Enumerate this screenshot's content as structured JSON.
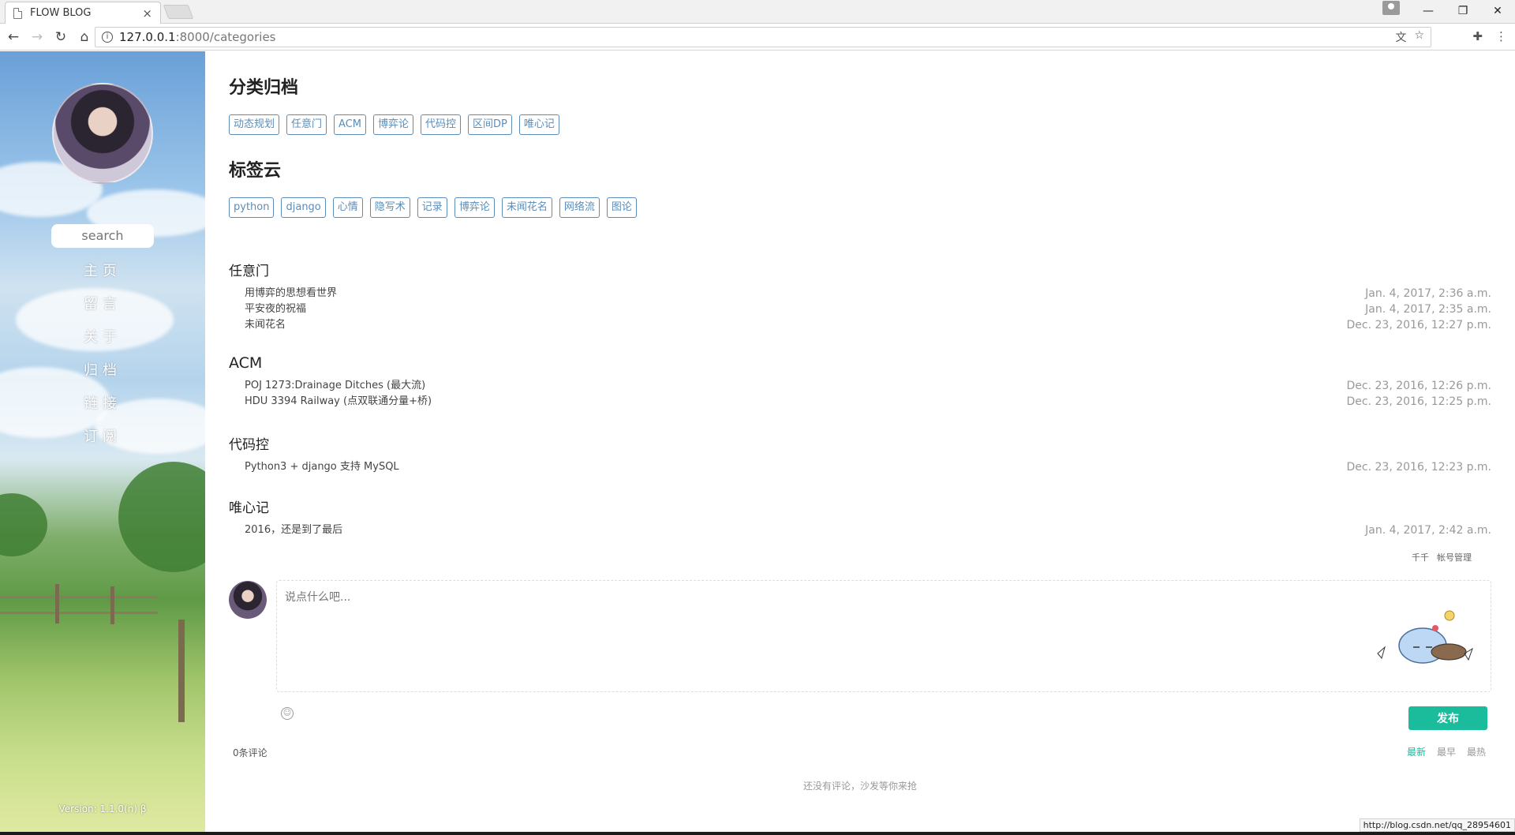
{
  "browser": {
    "tab_title": "FLOW BLOG",
    "tab_close": "×",
    "url_host": "127.0.0.1",
    "url_path": ":8000/categories",
    "status_url": "http://blog.csdn.net/qq_28954601"
  },
  "sidebar": {
    "search_placeholder": "search",
    "nav": [
      "主页",
      "留言",
      "关于",
      "归档",
      "链接",
      "订阅"
    ],
    "version": "Version: 1.1.0(n) β"
  },
  "main": {
    "category_title": "分类归档",
    "categories": [
      "动态规划",
      "任意门",
      "ACM",
      "博弈论",
      "代码控",
      "区间DP",
      "唯心记"
    ],
    "tagcloud_title": "标签云",
    "tags": [
      "python",
      "django",
      "心情",
      "隐写术",
      "记录",
      "博弈论",
      "未闻花名",
      "网络流",
      "图论"
    ],
    "groups": [
      {
        "name": "任意门",
        "posts": [
          {
            "title": "用博弈的思想看世界",
            "date": "Jan. 4, 2017, 2:36 a.m."
          },
          {
            "title": "平安夜的祝福",
            "date": "Jan. 4, 2017, 2:35 a.m."
          },
          {
            "title": "未闻花名",
            "date": "Dec. 23, 2016, 12:27 p.m."
          }
        ]
      },
      {
        "name": "ACM",
        "posts": [
          {
            "title": "POJ 1273:Drainage Ditches (最大流)",
            "date": "Dec. 23, 2016, 12:26 p.m."
          },
          {
            "title": "HDU 3394 Railway (点双联通分量+桥)",
            "date": "Dec. 23, 2016, 12:25 p.m."
          }
        ]
      },
      {
        "name": "代码控",
        "posts": [
          {
            "title": "Python3 + django 支持 MySQL",
            "date": "Dec. 23, 2016, 12:23 p.m."
          }
        ]
      },
      {
        "name": "唯心记",
        "posts": [
          {
            "title": "2016，还是到了最后",
            "date": "Jan. 4, 2017, 2:42 a.m."
          }
        ]
      }
    ]
  },
  "comments": {
    "user_name": "千千",
    "account_link": "帐号管理",
    "placeholder": "说点什么吧...",
    "publish_label": "发布",
    "count_label": "0条评论",
    "sort": [
      "最新",
      "最早",
      "最热"
    ],
    "empty_message": "还没有评论，沙发等你来抢"
  }
}
